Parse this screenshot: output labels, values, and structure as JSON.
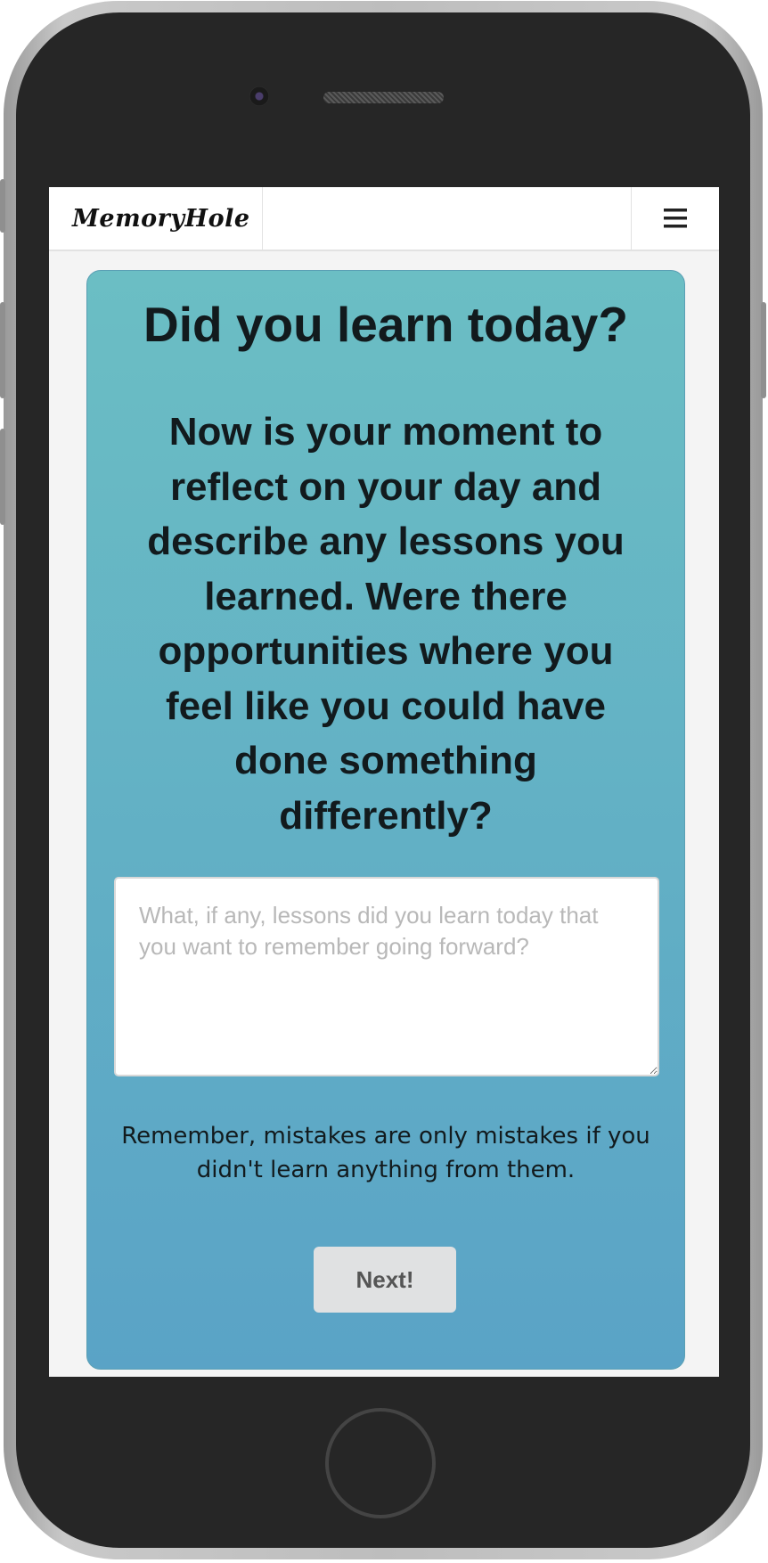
{
  "navbar": {
    "brand": "MemoryHole",
    "menu_icon": "hamburger-icon"
  },
  "prompt": {
    "title": "Did you learn today?",
    "subtitle": "Now is your moment to reflect on your day and describe any lessons you learned. Were there opportunities where you feel like you could have done something differently?"
  },
  "lesson_input": {
    "placeholder": "What, if any, lessons did you learn today that you want to remember going forward?",
    "value": ""
  },
  "reminder": "Remember, mistakes are only mistakes if you didn't learn anything from them.",
  "actions": {
    "next_label": "Next!"
  },
  "colors": {
    "card_top": "#6bbec4",
    "card_bottom": "#5aa3c6",
    "button_bg": "#e0e1e2"
  }
}
